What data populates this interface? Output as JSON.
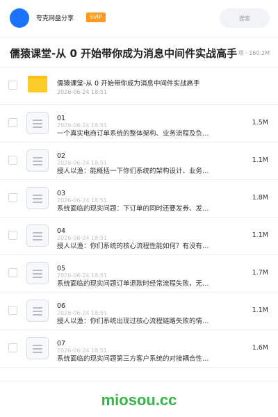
{
  "header": {
    "share_name": "夸克网盘分享",
    "badge": "SVIP",
    "search_placeholder": "搜索"
  },
  "folder": {
    "title": "儒猿课堂-从 0 开始带你成为消息中间件实战高手",
    "meta": "项 · 160.2M"
  },
  "items": [
    {
      "type": "folder",
      "name": "儒猿课堂-从 0 开始带你成为消息中间件实战高手",
      "date": "2026-06-24 18:51",
      "size": ""
    },
    {
      "type": "file",
      "num": "01",
      "name": "一个真实电商订单系统的整体架构、业务流程及负…",
      "date": "2026-06-24 18:51",
      "size": "1.5M"
    },
    {
      "type": "file",
      "num": "02",
      "name": "授人以渔：能概括一下你们系统的架构设计、业务…",
      "date": "2026-06-24 18:51",
      "size": "1.1M"
    },
    {
      "type": "file",
      "num": "03",
      "name": "系统面临的现实问题：下订单的同时还要发券、发…",
      "date": "2026-06-24 18:51",
      "size": "1.8M"
    },
    {
      "type": "file",
      "num": "04",
      "name": "授人以渔：你们系统的核心流程性能如何？有没有…",
      "date": "2026-06-24 18:51",
      "size": "1.1M"
    },
    {
      "type": "file",
      "num": "05",
      "name": "系统面临的现实问题订单退款时经常流程失败，无…",
      "date": "2026-06-24 18:51",
      "size": "1.7M"
    },
    {
      "type": "file",
      "num": "06",
      "name": "授人以渔：你们系统出现过核心流程链路失败的情…",
      "date": "2026-06-24 18:51",
      "size": "1.1M"
    },
    {
      "type": "file",
      "num": "07",
      "name": "系统面临的现实问题第三方客户系统的对接耦合性…",
      "date": "2026-06-24 18:51",
      "size": "1.6M"
    }
  ],
  "footer": {
    "brand": "miosou.cc"
  },
  "colors": {
    "avatar": "#1a73ff",
    "svip_badge": "#ff9a1f",
    "folder_yellow": "#fccc2a",
    "brand_green": "#36b34a"
  },
  "icons": {
    "folder": "folder-icon",
    "file": "document-icon"
  }
}
